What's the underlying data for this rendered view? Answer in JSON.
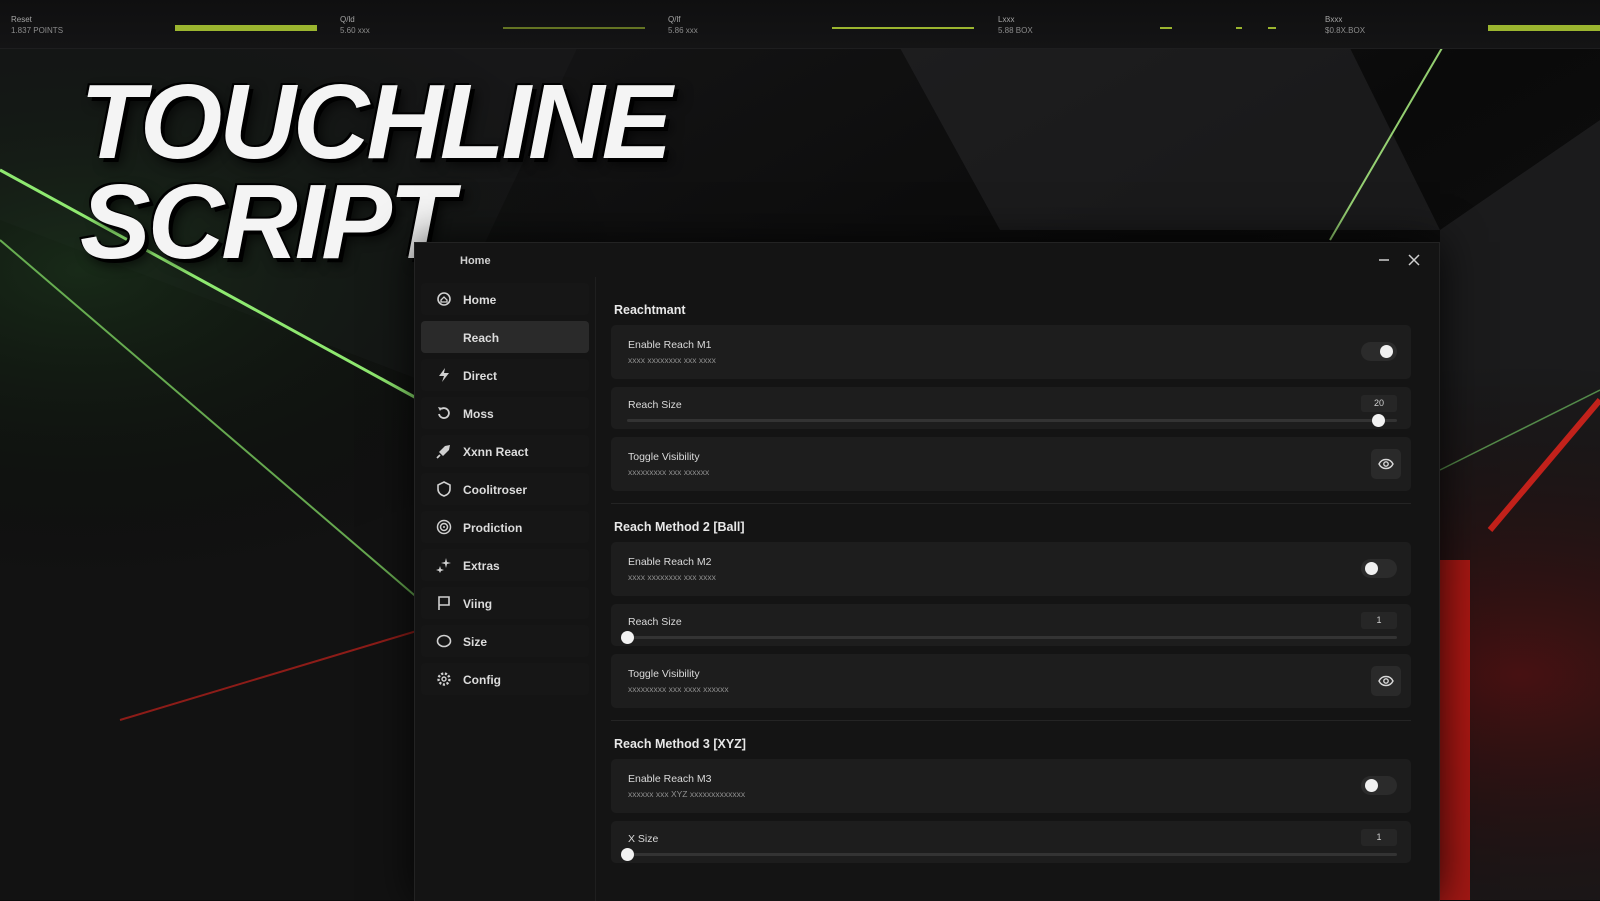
{
  "hero": {
    "line1": "TOUCHLINE",
    "line2": "SCRIPT"
  },
  "topbar": {
    "stats": [
      {
        "label": "Reset",
        "value": "1.837 POINTS"
      },
      {
        "label": "Q/ld",
        "value": "5.60 xxx"
      },
      {
        "label": "Q/lf",
        "value": "5.86 xxx"
      },
      {
        "label": "Lxxx",
        "value": "5.88 BOX"
      },
      {
        "label": "Bxxx",
        "value": "$0.8X.BOX"
      }
    ]
  },
  "window": {
    "title": "Home",
    "minimize_icon": "minimize-icon",
    "close_icon": "close-icon"
  },
  "sidebar": {
    "items": [
      {
        "label": "Home",
        "icon": "home-icon",
        "active": false
      },
      {
        "label": "Reach",
        "icon": "",
        "active": true
      },
      {
        "label": "Direct",
        "icon": "bolt-icon",
        "active": false
      },
      {
        "label": "Moss",
        "icon": "rotate-icon",
        "active": false
      },
      {
        "label": "Xxnn React",
        "icon": "rocket-icon",
        "active": false
      },
      {
        "label": "Coolitroser",
        "icon": "shield-icon",
        "active": false
      },
      {
        "label": "Prodiction",
        "icon": "target-icon",
        "active": false
      },
      {
        "label": "Extras",
        "icon": "sparkle-icon",
        "active": false
      },
      {
        "label": "Viing",
        "icon": "flag-icon",
        "active": false
      },
      {
        "label": "Size",
        "icon": "circle-icon",
        "active": false
      },
      {
        "label": "Config",
        "icon": "gear-icon",
        "active": false
      }
    ]
  },
  "sections": [
    {
      "title": "Reachtmant",
      "toggle": {
        "title": "Enable Reach M1",
        "subtitle": "xxxx xxxxxxxx xxx xxxx",
        "on": true
      },
      "slider": {
        "title": "Reach Size",
        "value": "20",
        "fraction": 0.975
      },
      "visibility": {
        "title": "Toggle Visibility",
        "subtitle": "xxxxxxxxx xxx xxxxxx"
      }
    },
    {
      "title": "Reach Method 2 [Ball]",
      "toggle": {
        "title": "Enable Reach M2",
        "subtitle": "xxxx xxxxxxxx xxx xxxx",
        "on": false
      },
      "slider": {
        "title": "Reach Size",
        "value": "1",
        "fraction": 0.0
      },
      "visibility": {
        "title": "Toggle Visibility",
        "subtitle": "xxxxxxxxx xxx xxxx xxxxxx"
      }
    },
    {
      "title": "Reach Method 3 [XYZ]",
      "toggle": {
        "title": "Enable Reach M3",
        "subtitle": "xxxxxx xxx XYZ xxxxxxxxxxxxx",
        "on": false
      },
      "slider": {
        "title": "X Size",
        "value": "1",
        "fraction": 0.0
      }
    }
  ],
  "colors": {
    "accent_green": "#9bb52f",
    "accent_red": "#e0241c",
    "panel": "#141414",
    "row": "#1d1d1d"
  }
}
